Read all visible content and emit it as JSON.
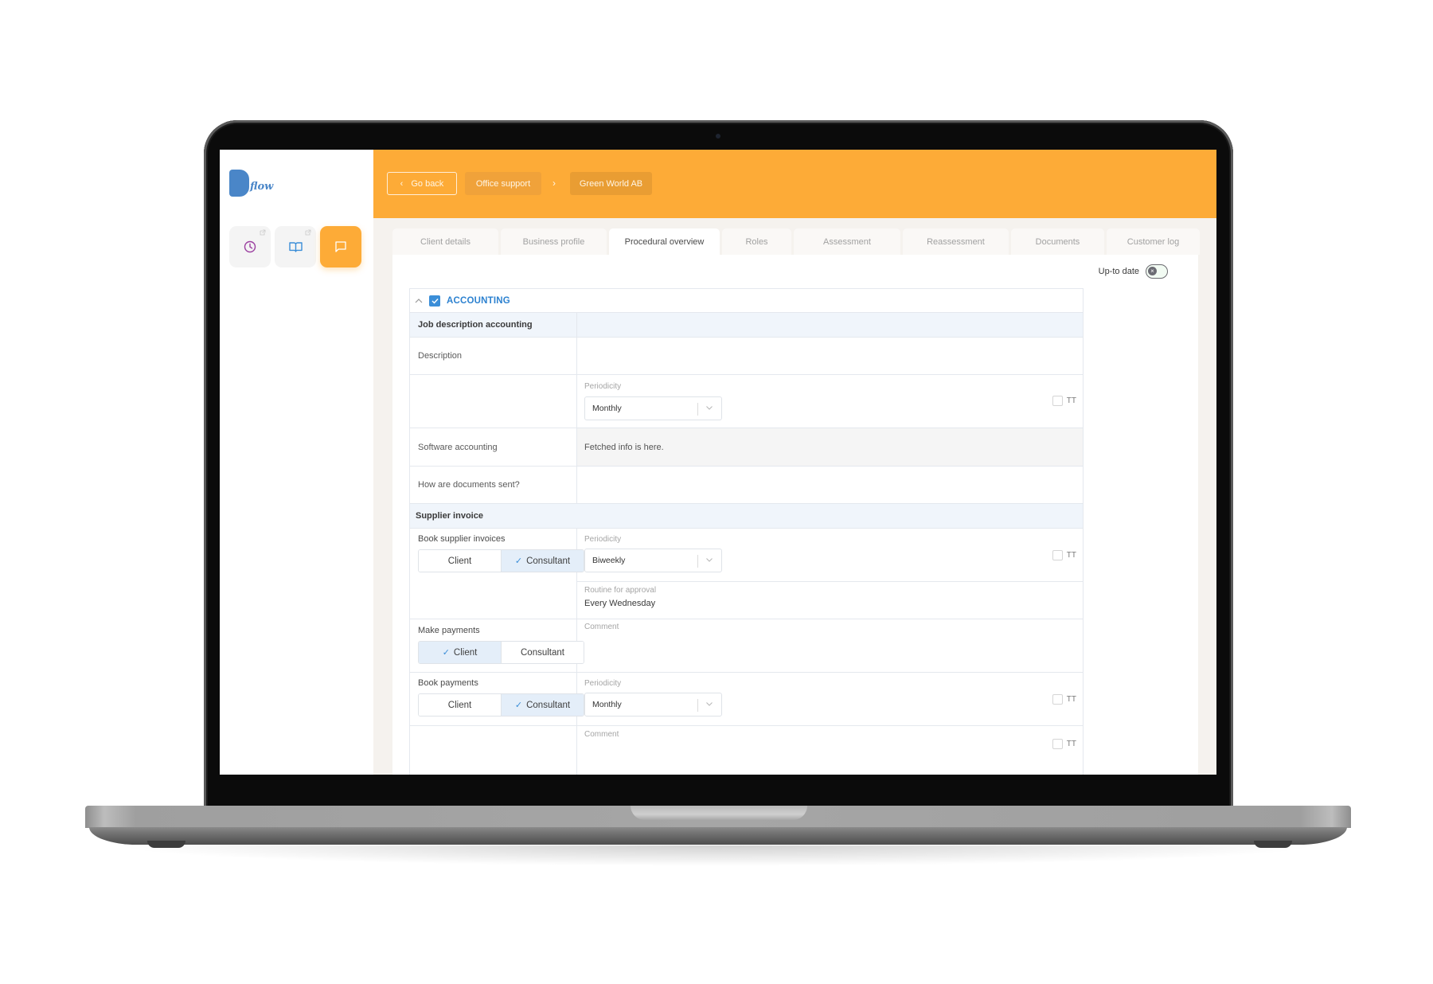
{
  "app": {
    "logo_text": "flow",
    "accent_color": "#fdab37",
    "link_color": "#2d82d0"
  },
  "sidebar": {
    "tiles": [
      {
        "icon": "clock-icon",
        "has_external_link": true,
        "active": false
      },
      {
        "icon": "book-icon",
        "has_external_link": true,
        "active": false
      },
      {
        "icon": "chat-icon",
        "has_external_link": false,
        "active": true
      }
    ]
  },
  "header": {
    "back_label": "Go back",
    "breadcrumb": [
      "Office support",
      "Green World AB"
    ]
  },
  "tabs": [
    {
      "label": "Client details",
      "active": false
    },
    {
      "label": "Business profile",
      "active": false
    },
    {
      "label": "Procedural overview",
      "active": true
    },
    {
      "label": "Roles",
      "active": false
    },
    {
      "label": "Assessment",
      "active": false
    },
    {
      "label": "Reassessment",
      "active": false
    },
    {
      "label": "Documents",
      "active": false
    },
    {
      "label": "Customer log",
      "active": false
    }
  ],
  "uptodate": {
    "label": "Up-to date",
    "on": false,
    "knob_glyph": "×"
  },
  "section": {
    "title": "ACCOUNTING",
    "checked": true,
    "expanded": true,
    "job_description": {
      "heading": "Job description accounting",
      "description_label": "Description",
      "periodicity_label": "Periodicity",
      "periodicity_value": "Monthly",
      "tt_label": "TT",
      "software_label": "Software accounting",
      "software_value": "Fetched info is here.",
      "docs_label": "How are documents sent?"
    },
    "supplier_invoice": {
      "heading": "Supplier invoice",
      "book_supplier": {
        "label": "Book supplier invoices",
        "options": [
          "Client",
          "Consultant"
        ],
        "selected": "Consultant",
        "periodicity_label": "Periodicity",
        "periodicity_value": "Biweekly",
        "tt_label": "TT",
        "routine_label": "Routine for approval",
        "routine_value": "Every Wednesday"
      },
      "make_payments": {
        "label": "Make payments",
        "options": [
          "Client",
          "Consultant"
        ],
        "selected": "Client",
        "comment_label": "Comment"
      },
      "book_payments": {
        "label": "Book payments",
        "options": [
          "Client",
          "Consultant"
        ],
        "selected": "Consultant",
        "periodicity_label": "Periodicity",
        "periodicity_value": "Monthly",
        "tt_label": "TT",
        "comment_label": "Comment",
        "comment_tt_label": "TT"
      }
    },
    "check_glyph": "✓"
  }
}
